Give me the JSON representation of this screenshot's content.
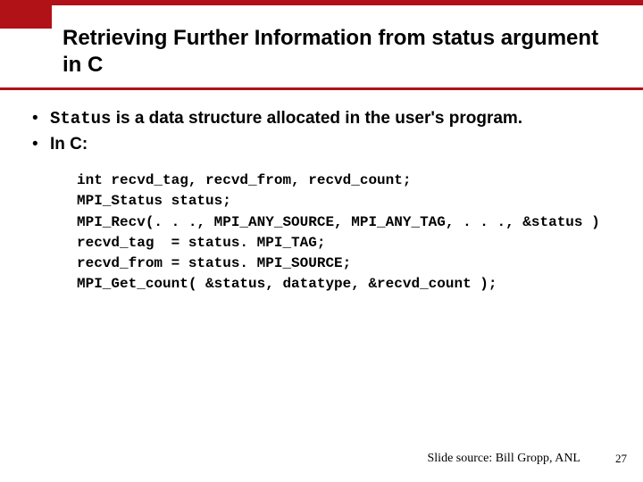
{
  "title": "Retrieving Further Information from status argument in C",
  "bullets": [
    {
      "leading_code": "Status",
      "rest": " is a data structure allocated in the user's program."
    },
    {
      "leading_code": "",
      "rest": "In C:"
    }
  ],
  "code_lines": [
    "int recvd_tag, recvd_from, recvd_count;",
    "MPI_Status status;",
    "MPI_Recv(. . ., MPI_ANY_SOURCE, MPI_ANY_TAG, . . ., &status )",
    "recvd_tag  = status. MPI_TAG;",
    "recvd_from = status. MPI_SOURCE;",
    "MPI_Get_count( &status, datatype, &recvd_count );"
  ],
  "footer_source": "Slide source: Bill Gropp, ANL",
  "page_number": "27"
}
